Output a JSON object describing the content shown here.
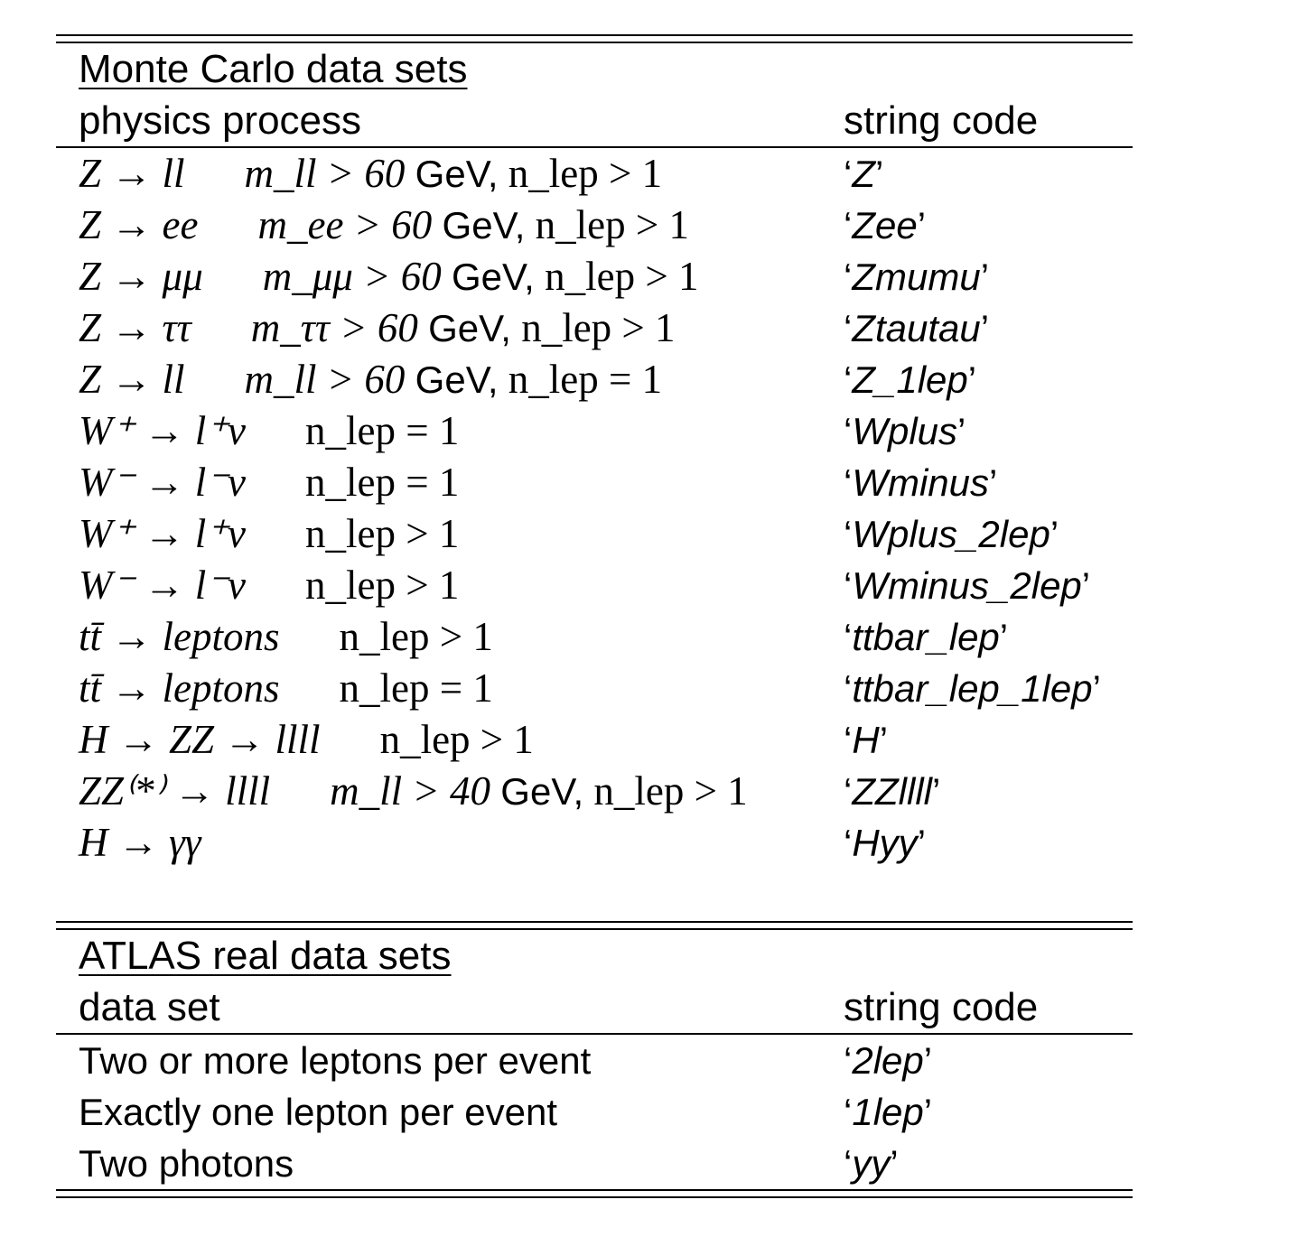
{
  "monte_carlo": {
    "title": "Monte Carlo data sets",
    "col_process": "physics process",
    "col_code": "string code",
    "rows": [
      {
        "process": "Z → ll",
        "mass": "m_ll > 60",
        "unit": "GeV,",
        "nlep": "n_lep > 1",
        "code": "Z"
      },
      {
        "process": "Z → ee",
        "mass": "m_ee > 60",
        "unit": "GeV,",
        "nlep": "n_lep > 1",
        "code": "Zee"
      },
      {
        "process": "Z → μμ",
        "mass": "m_μμ > 60",
        "unit": "GeV,",
        "nlep": "n_lep > 1",
        "code": "Zmumu"
      },
      {
        "process": "Z → ττ",
        "mass": "m_ττ > 60",
        "unit": "GeV,",
        "nlep": "n_lep > 1",
        "code": "Ztautau"
      },
      {
        "process": "Z → ll",
        "mass": "m_ll > 60",
        "unit": "GeV,",
        "nlep": "n_lep = 1",
        "code": "Z_1lep"
      },
      {
        "process": "W⁺ → l⁺ν",
        "mass": "",
        "unit": "",
        "nlep": "n_lep = 1",
        "code": "Wplus"
      },
      {
        "process": "W⁻ → l⁻ν",
        "mass": "",
        "unit": "",
        "nlep": "n_lep = 1",
        "code": "Wminus"
      },
      {
        "process": "W⁺ → l⁺ν",
        "mass": "",
        "unit": "",
        "nlep": "n_lep > 1",
        "code": "Wplus_2lep"
      },
      {
        "process": "W⁻ → l⁻ν",
        "mass": "",
        "unit": "",
        "nlep": "n_lep > 1",
        "code": "Wminus_2lep"
      },
      {
        "process": "tt̄ → leptons",
        "mass": "",
        "unit": "",
        "nlep": "n_lep > 1",
        "code": "ttbar_lep"
      },
      {
        "process": "tt̄ → leptons",
        "mass": "",
        "unit": "",
        "nlep": "n_lep = 1",
        "code": "ttbar_lep_1lep"
      },
      {
        "process": "H → ZZ → llll",
        "mass": "",
        "unit": "",
        "nlep": "n_lep > 1",
        "code": "H"
      },
      {
        "process": "ZZ⁽*⁾ → llll",
        "mass": "m_ll > 40",
        "unit": "GeV,",
        "nlep": "n_lep > 1",
        "code": "ZZllll"
      },
      {
        "process": "H → γγ",
        "mass": "",
        "unit": "",
        "nlep": "",
        "code": "Hyy"
      }
    ]
  },
  "atlas": {
    "title": "ATLAS real data sets",
    "col_dataset": "data set",
    "col_code": "string code",
    "rows": [
      {
        "dataset": "Two or more leptons per event",
        "code": "2lep"
      },
      {
        "dataset": "Exactly one lepton per event",
        "code": "1lep"
      },
      {
        "dataset": "Two photons",
        "code": "yy"
      }
    ]
  }
}
